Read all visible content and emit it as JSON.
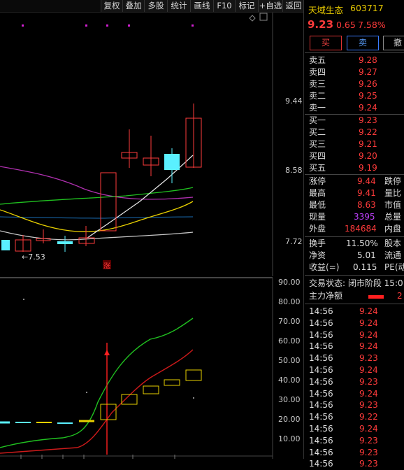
{
  "toolbar": [
    "复权",
    "叠加",
    "多股",
    "统计",
    "画线",
    "F10",
    "标记",
    "+自选",
    "返回"
  ],
  "kchart": {
    "y_labels": [
      "9.44",
      "8.58",
      "7.72"
    ],
    "low_annotation": "←7.53",
    "limit_up_marker": "涨"
  },
  "volchart": {
    "y_labels": [
      "90.00",
      "80.00",
      "70.00",
      "60.00",
      "50.00",
      "40.00",
      "30.00",
      "20.00",
      "10.00"
    ]
  },
  "quote": {
    "name": "天域生态",
    "code": "603717",
    "price": "9.23",
    "change": "0.65",
    "change_pct": "7.58%",
    "buy_btn": "买",
    "sell_btn": "卖",
    "cancel_btn": "撤",
    "asks": [
      {
        "label": "卖五",
        "price": "9.28"
      },
      {
        "label": "卖四",
        "price": "9.27"
      },
      {
        "label": "卖三",
        "price": "9.26"
      },
      {
        "label": "卖二",
        "price": "9.25"
      },
      {
        "label": "卖一",
        "price": "9.24"
      }
    ],
    "bids": [
      {
        "label": "买一",
        "price": "9.23"
      },
      {
        "label": "买二",
        "price": "9.22"
      },
      {
        "label": "买三",
        "price": "9.21"
      },
      {
        "label": "买四",
        "price": "9.20"
      },
      {
        "label": "买五",
        "price": "9.19"
      }
    ],
    "stats": [
      {
        "label": "涨停",
        "value": "9.44",
        "color": "red",
        "label2": "跌停"
      },
      {
        "label": "最高",
        "value": "9.41",
        "color": "red",
        "label2": "量比"
      },
      {
        "label": "最低",
        "value": "8.63",
        "color": "red",
        "label2": "市值"
      },
      {
        "label": "现量",
        "value": "3395",
        "color": "purple",
        "label2": "总量"
      },
      {
        "label": "外盘",
        "value": "184684",
        "color": "red",
        "label2": "内盘"
      }
    ],
    "stats2": [
      {
        "label": "换手",
        "value": "11.50%",
        "label2": "股本"
      },
      {
        "label": "净资",
        "value": "5.01",
        "label2": "流通"
      },
      {
        "label": "收益(=)",
        "value": "0.115",
        "label2": "PE(动"
      }
    ],
    "trade_status": "交易状态: 闭市阶段 15:0",
    "main_force": "主力净额",
    "main_force_value": "2",
    "ticks": [
      {
        "time": "14:56",
        "price": "9.24"
      },
      {
        "time": "14:56",
        "price": "9.24"
      },
      {
        "time": "14:56",
        "price": "9.24"
      },
      {
        "time": "14:56",
        "price": "9.24"
      },
      {
        "time": "14:56",
        "price": "9.23"
      },
      {
        "time": "14:56",
        "price": "9.24"
      },
      {
        "time": "14:56",
        "price": "9.23"
      },
      {
        "time": "14:56",
        "price": "9.24"
      },
      {
        "time": "14:56",
        "price": "9.23"
      },
      {
        "time": "14:56",
        "price": "9.22"
      },
      {
        "time": "14:56",
        "price": "9.24"
      },
      {
        "time": "14:56",
        "price": "9.23"
      },
      {
        "time": "14:56",
        "price": "9.23"
      },
      {
        "time": "14:56",
        "price": "9.23"
      }
    ]
  },
  "colors": {
    "up": "#ff3b3b",
    "down": "#5af0ff",
    "ma1": "#c8c8c8",
    "ma2": "#e8d000",
    "ma3": "#c030c0",
    "ma4": "#20c020"
  }
}
